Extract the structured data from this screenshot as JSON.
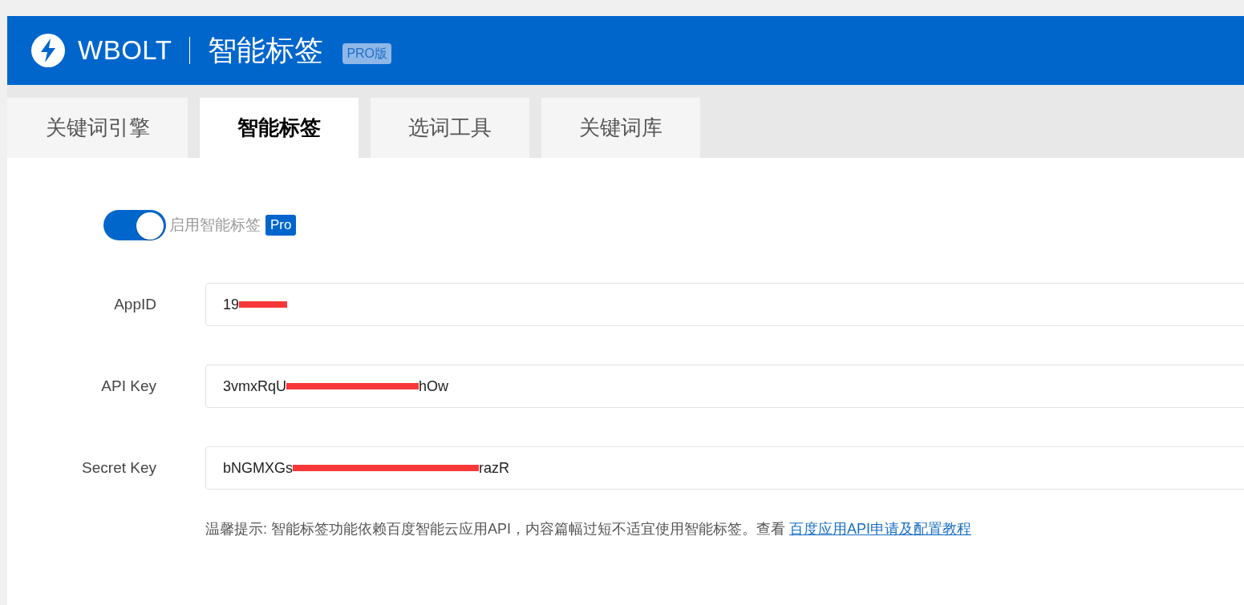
{
  "header": {
    "brand": "WBOLT",
    "title": "智能标签",
    "badge": "PRO版"
  },
  "tabs": [
    {
      "label": "关键词引擎",
      "selected": false
    },
    {
      "label": "智能标签",
      "selected": true
    },
    {
      "label": "选词工具",
      "selected": false
    },
    {
      "label": "关键词库",
      "selected": false
    }
  ],
  "toggle": {
    "label": "启用智能标签",
    "on": true,
    "badge": "Pro"
  },
  "fields": [
    {
      "label": "AppID",
      "value_start": "19",
      "redacted": true
    },
    {
      "label": "API Key",
      "value_start": "3vmxRqU",
      "value_end": "hOw",
      "redacted": true
    },
    {
      "label": "Secret Key",
      "value_start": "bNGMXGs",
      "value_end": "razR",
      "redacted": true
    }
  ],
  "hint": {
    "text": "温馨提示: 智能标签功能依赖百度智能云应用API，内容篇幅过短不适宜使用智能标签。查看",
    "link": "百度应用API申请及配置教程"
  }
}
